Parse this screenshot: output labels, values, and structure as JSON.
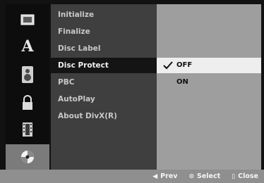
{
  "menu": {
    "items": [
      {
        "label": "Initialize"
      },
      {
        "label": "Finalize"
      },
      {
        "label": "Disc Label"
      },
      {
        "label": "Disc Protect"
      },
      {
        "label": "PBC"
      },
      {
        "label": "AutoPlay"
      },
      {
        "label": "About DivX(R)"
      }
    ],
    "selected_index": 3
  },
  "options": {
    "items": [
      {
        "label": "OFF"
      },
      {
        "label": "ON"
      }
    ],
    "selected_index": 0
  },
  "icons": [
    {
      "name": "display-icon"
    },
    {
      "name": "language-icon",
      "glyph": "A"
    },
    {
      "name": "audio-speaker-icon"
    },
    {
      "name": "lock-icon"
    },
    {
      "name": "film-strip-icon"
    },
    {
      "name": "disc-icon"
    }
  ],
  "help_bar": {
    "prev_symbol": "◀",
    "prev_label": "Prev",
    "select_symbol": "⊙",
    "select_label": "Select",
    "close_symbol": "▯",
    "close_label": "Close"
  },
  "colors": {
    "menu_bg": "#3f3f3f",
    "menu_selected_bg": "#141414",
    "options_bg": "#9e9e9e",
    "options_selected_bg": "#eeeeee",
    "help_bar_bg": "#8f8f8f",
    "active_icon_bg": "#7b7b7b"
  }
}
